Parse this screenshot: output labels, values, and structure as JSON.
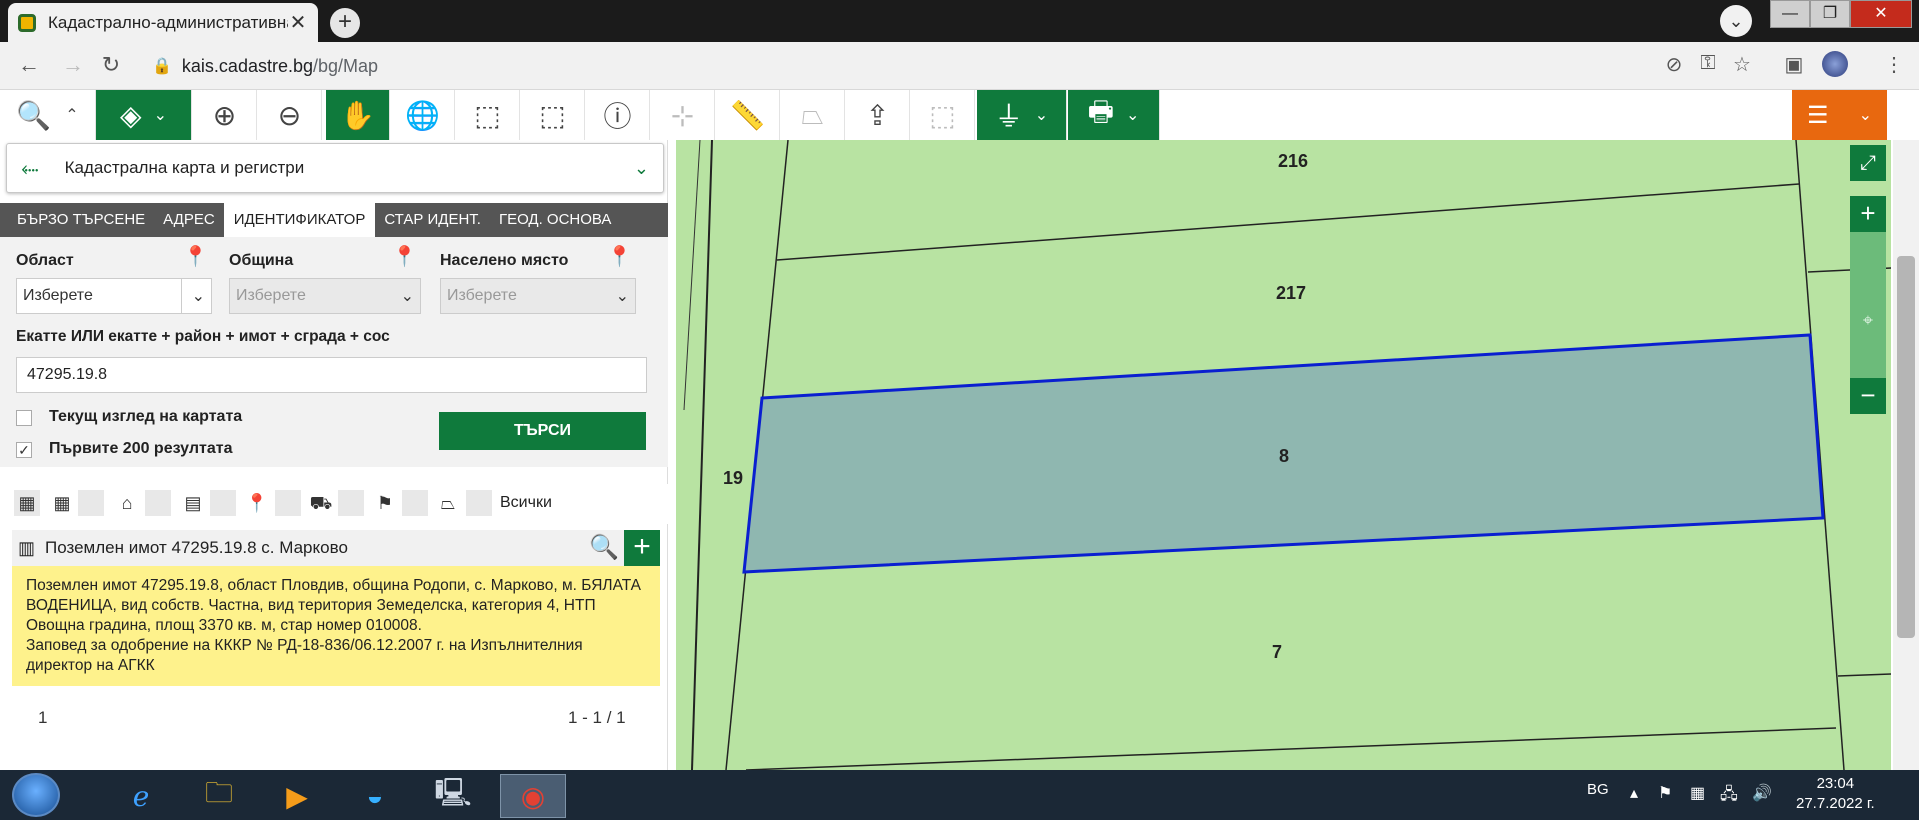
{
  "browser": {
    "tab_title": "Кадастрално-административна",
    "tab_close": "✕",
    "new_tab": "+",
    "url_host": "kais.cadastre.bg",
    "url_path": "/bg/Map",
    "window_controls": {
      "minimize": "—",
      "maximize": "❐",
      "close": "✕"
    }
  },
  "app": {
    "layer_selector": "Кадастрална карта и регистри",
    "search_tabs": [
      {
        "label": "БЪРЗО ТЪРСЕНЕ",
        "active": false
      },
      {
        "label": "АДРЕС",
        "active": false
      },
      {
        "label": "ИДЕНТИФИКАТОР",
        "active": true
      },
      {
        "label": "СТАР ИДЕНТ.",
        "active": false
      },
      {
        "label": "ГЕОД. ОСНОВА",
        "active": false
      }
    ],
    "form": {
      "region_label": "Област",
      "region_value": "Изберете",
      "municipality_label": "Община",
      "municipality_value": "Изберете",
      "settlement_label": "Населено място",
      "settlement_value": "Изберете",
      "id_label": "Екатте ИЛИ екатте + район + имот + сграда + сос",
      "id_value": "47295.19.8",
      "current_view_label": "Текущ изглед на картата",
      "current_view_checked": false,
      "first200_label": "Първите 200 резултата",
      "first200_checked": true,
      "search_button": "ТЪРСИ"
    },
    "filter_all_label": "Всички",
    "result": {
      "title": "Поземлен имот 47295.19.8 с. Марково",
      "description_line1": "Поземлен имот 47295.19.8, област Пловдив, община Родопи, с. Марково, м. БЯЛАТА ВОДЕНИЦА, вид собств. Частна, вид територия Земеделска, категория 4, НТП Овощна градина, площ 3370 кв. м, стар номер 010008.",
      "description_line2": "Заповед за одобрение на КККР № РД-18-836/06.12.2007 г. на Изпълнителния директор на АГКК"
    },
    "pagination": {
      "page": "1",
      "range": "1 - 1 / 1"
    }
  },
  "map": {
    "parcel_labels": {
      "p216": "216",
      "p217": "217",
      "p8": "8",
      "p7": "7",
      "p19": "19"
    },
    "selected_parcel": "8",
    "colors": {
      "land": "#b8e3a2",
      "selected_fill": "#8fb7b0",
      "selected_stroke": "#0a1fd0",
      "brand_green": "#0f7a3c",
      "menu_orange": "#e8680f"
    }
  },
  "taskbar": {
    "language": "BG",
    "time": "23:04",
    "date": "27.7.2022 г."
  }
}
